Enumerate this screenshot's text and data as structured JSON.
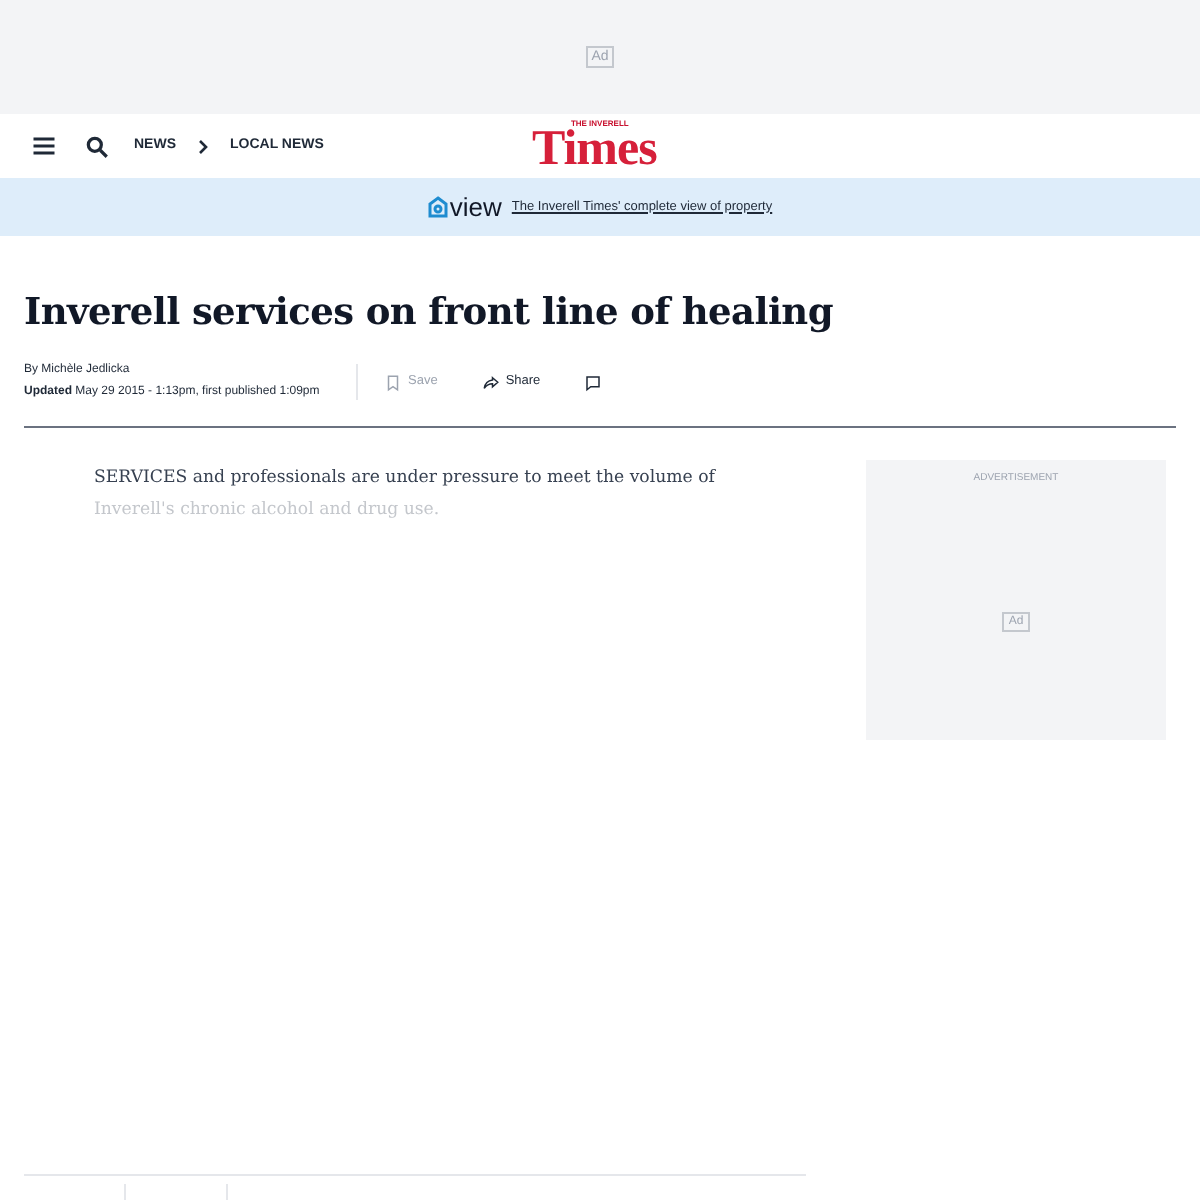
{
  "top_ad": {
    "label": "Ad"
  },
  "nav": {
    "breadcrumbs": [
      "NEWS",
      "LOCAL NEWS"
    ],
    "logo_small": "THE INVERELL",
    "logo": "Times"
  },
  "promo": {
    "brand": "view",
    "link": "The Inverell Times' complete view of property"
  },
  "article": {
    "headline": "Inverell services on front line of healing",
    "byline": "By Michèle Jedlicka",
    "updated_label": "Updated",
    "updated": "May 29 2015 - 1:13pm, first published 1:09pm",
    "actions": [
      {
        "kind": "save",
        "label": "Save",
        "disabled": true
      },
      {
        "kind": "share",
        "label": "Share",
        "disabled": false
      },
      {
        "kind": "comment",
        "disabled": false
      }
    ],
    "lead": "SERVICES and professionals are under pressure to meet the volume of",
    "lead_faded": "Inverell's chronic alcohol and drug use."
  },
  "side_ad": {
    "caption": "ADVERTISEMENT",
    "label": "Ad"
  }
}
